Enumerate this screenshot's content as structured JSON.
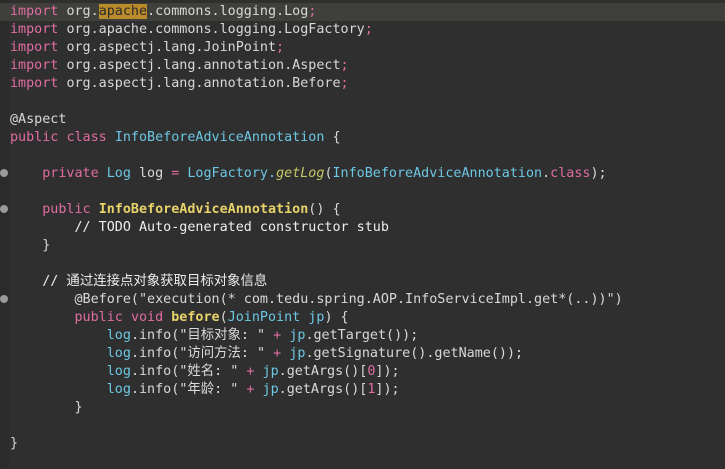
{
  "editor": {
    "imports": [
      {
        "kw": "import",
        "path_a": "org.",
        "path_hl": "apache",
        "path_b": ".commons.logging.Log",
        "end": ";"
      },
      {
        "kw": "import",
        "path": "org.apache.commons.logging.LogFactory",
        "end": ";"
      },
      {
        "kw": "import",
        "path": "org.aspectj.lang.JoinPoint",
        "end": ";"
      },
      {
        "kw": "import",
        "path": "org.aspectj.lang.annotation.Aspect",
        "end": ";"
      },
      {
        "kw": "import",
        "path": "org.aspectj.lang.annotation.Before",
        "end": ";"
      }
    ],
    "annotation_aspect": "@Aspect",
    "class_decl": {
      "mod": "public",
      "kw": "class",
      "name": "InfoBeforeAdviceAnnotation",
      "brace": " {"
    },
    "field": {
      "mod": "private",
      "type": "Log",
      "name": " log ",
      "eq": "=",
      "factory": " LogFactory.",
      "method": "getLog",
      "open": "(",
      "arg": "InfoBeforeAdviceAnnotation",
      "dot": ".",
      "argkw": "class",
      "close": ");"
    },
    "ctor": {
      "mod": "public",
      "name": "InfoBeforeAdviceAnnotation",
      "rest": "() {"
    },
    "todo": "// TODO Auto-generated constructor stub",
    "close_brace": "}",
    "comment_cn": "// 通过连接点对象获取目标对象信息",
    "before_ann": "@Before(\"execution(* com.tedu.spring.AOP.InfoServiceImpl.get*(..))\")",
    "method_decl": {
      "mod": "public",
      "ret": "void",
      "name": "before",
      "open": "(",
      "ptype": "JoinPoint",
      "pname": " jp",
      "rest": ") {"
    },
    "log_lines": [
      {
        "obj": "log",
        "call": ".info(",
        "str": "\"目标对象: \"",
        "plus": " + ",
        "var": "jp",
        "rest": ".getTarget());"
      },
      {
        "obj": "log",
        "call": ".info(",
        "str": "\"访问方法: \"",
        "plus": " + ",
        "var": "jp",
        "rest": ".getSignature().getName());"
      },
      {
        "obj": "log",
        "call": ".info(",
        "str": "\"姓名: \"",
        "plus": " + ",
        "var": "jp",
        "rest1": ".getArgs()[",
        "idx": "0",
        "rest2": "]);"
      },
      {
        "obj": "log",
        "call": ".info(",
        "str": "\"年龄: \"",
        "plus": " + ",
        "var": "jp",
        "rest1": ".getArgs()[",
        "idx": "1",
        "rest2": "]);"
      }
    ]
  },
  "colors": {
    "background": "#2f2f2f",
    "keyword": "#e06da1",
    "type": "#6cc7e3",
    "declaration": "#e8d36a",
    "text": "#d8d8d8",
    "highlight": "#b98b2a"
  }
}
